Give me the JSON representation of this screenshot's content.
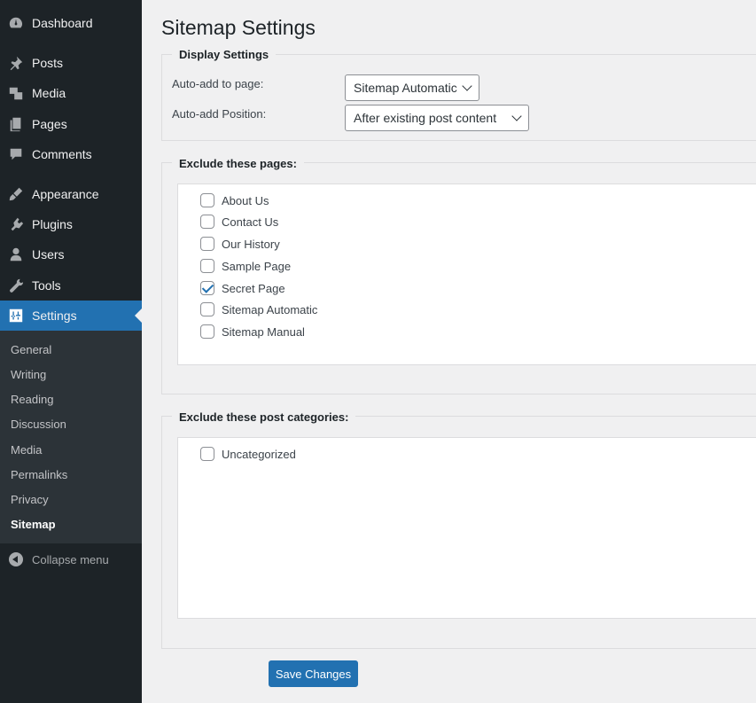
{
  "sidebar": {
    "items": [
      {
        "label": "Dashboard",
        "icon": "dashboard-icon"
      },
      {
        "label": "Posts",
        "icon": "pin-icon"
      },
      {
        "label": "Media",
        "icon": "media-icon"
      },
      {
        "label": "Pages",
        "icon": "pages-icon"
      },
      {
        "label": "Comments",
        "icon": "comment-icon"
      },
      {
        "label": "Appearance",
        "icon": "brush-icon"
      },
      {
        "label": "Plugins",
        "icon": "plugin-icon"
      },
      {
        "label": "Users",
        "icon": "user-icon"
      },
      {
        "label": "Tools",
        "icon": "wrench-icon"
      },
      {
        "label": "Settings",
        "icon": "settings-icon",
        "active": true
      }
    ],
    "submenu": [
      "General",
      "Writing",
      "Reading",
      "Discussion",
      "Media",
      "Permalinks",
      "Privacy",
      "Sitemap"
    ],
    "current_submenu": "Sitemap",
    "collapse_label": "Collapse menu"
  },
  "page": {
    "title": "Sitemap Settings"
  },
  "display_settings": {
    "legend": "Display Settings",
    "auto_add_page_label": "Auto-add to page:",
    "auto_add_page_value": "Sitemap Automatic",
    "auto_add_position_label": "Auto-add Position:",
    "auto_add_position_value": "After existing post content"
  },
  "exclude_pages": {
    "legend": "Exclude these pages:",
    "items": [
      {
        "label": "About Us",
        "checked": false
      },
      {
        "label": "Contact Us",
        "checked": false
      },
      {
        "label": "Our History",
        "checked": false
      },
      {
        "label": "Sample Page",
        "checked": false
      },
      {
        "label": "Secret Page",
        "checked": true
      },
      {
        "label": "Sitemap Automatic",
        "checked": false
      },
      {
        "label": "Sitemap Manual",
        "checked": false
      }
    ]
  },
  "exclude_categories": {
    "legend": "Exclude these post categories:",
    "items": [
      {
        "label": "Uncategorized",
        "checked": false
      }
    ]
  },
  "save_label": "Save Changes",
  "colors": {
    "sidebar_bg": "#1d2327",
    "accent": "#2271b1",
    "page_bg": "#f0f0f1"
  }
}
